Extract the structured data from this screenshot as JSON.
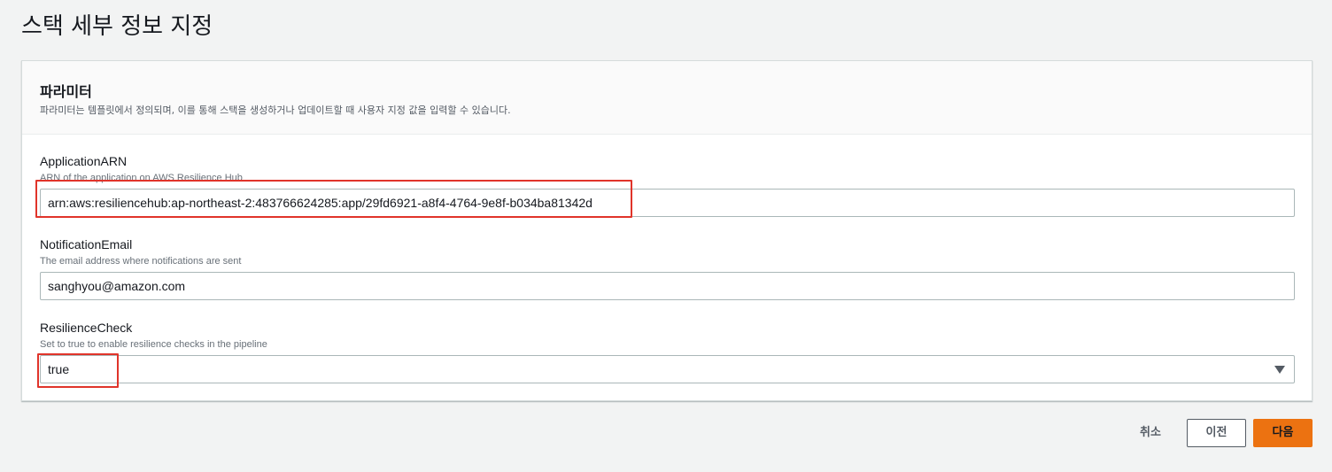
{
  "page": {
    "title": "스택 세부 정보 지정"
  },
  "parameters": {
    "title": "파라미터",
    "description": "파라미터는 템플릿에서 정의되며, 이를 통해 스택을 생성하거나 업데이트할 때 사용자 지정 값을 입력할 수 있습니다.",
    "fields": [
      {
        "label": "ApplicationARN",
        "description": "ARN of the application on AWS Resilience Hub",
        "value": "arn:aws:resiliencehub:ap-northeast-2:483766624285:app/29fd6921-a8f4-4764-9e8f-b034ba81342d"
      },
      {
        "label": "NotificationEmail",
        "description": "The email address where notifications are sent",
        "value": "sanghyou@amazon.com"
      },
      {
        "label": "ResilienceCheck",
        "description": "Set to true to enable resilience checks in the pipeline",
        "value": "true"
      }
    ]
  },
  "actions": {
    "cancel_label": "취소",
    "previous_label": "이전",
    "next_label": "다음"
  },
  "colors": {
    "primary_button": "#ec7211",
    "highlight_box": "#e0342a",
    "background": "#f2f3f3"
  }
}
